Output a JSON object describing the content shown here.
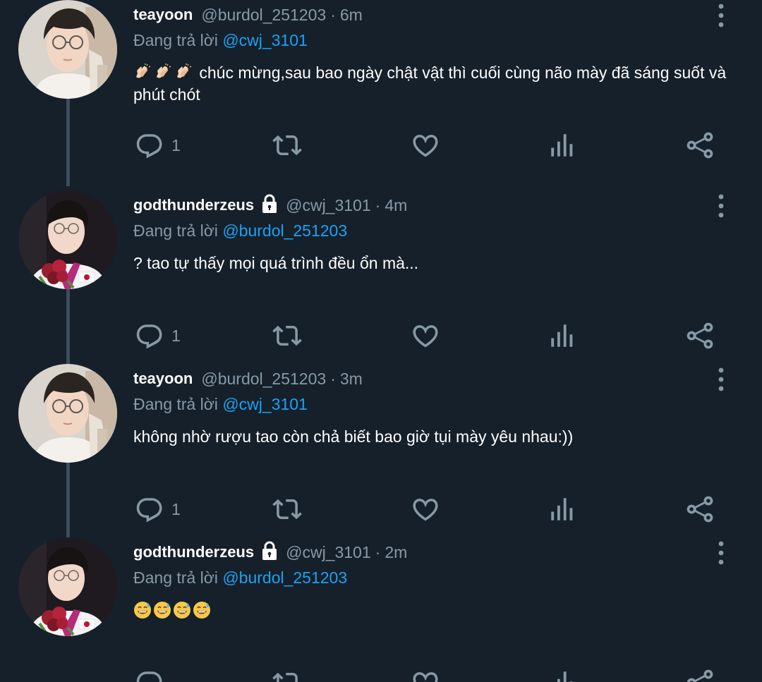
{
  "tweets": [
    {
      "name": "teayoon",
      "locked": false,
      "handle": "@burdol_251203",
      "dot": "·",
      "time": "6m",
      "reply_prefix": "Đang trả lời",
      "reply_to": "@cwj_3101",
      "emoji": "clapping-hands x3",
      "text": "chúc mừng,sau bao ngày chật vật thì cuối cùng não mày đã sáng suốt và phút chót",
      "reply_count": "1",
      "avatar": "profile-photo-teayoon"
    },
    {
      "name": "godthunderzeus",
      "locked": true,
      "handle": "@cwj_3101",
      "dot": "·",
      "time": "4m",
      "reply_prefix": "Đang trả lời",
      "reply_to": "@burdol_251203",
      "text": "? tao tự thấy mọi quá trình đều ổn mà...",
      "reply_count": "1",
      "avatar": "profile-photo-godthunderzeus"
    },
    {
      "name": "teayoon",
      "locked": false,
      "handle": "@burdol_251203",
      "dot": "·",
      "time": "3m",
      "reply_prefix": "Đang trả lời",
      "reply_to": "@cwj_3101",
      "text": "không nhờ rượu tao còn chả biết bao giờ tụi mày yêu nhau:))",
      "reply_count": "1",
      "avatar": "profile-photo-teayoon"
    },
    {
      "name": "godthunderzeus",
      "locked": true,
      "handle": "@cwj_3101",
      "dot": "·",
      "time": "2m",
      "reply_prefix": "Đang trả lời",
      "reply_to": "@burdol_251203",
      "emoji": "grinning-face-with-sweat x4",
      "text": "",
      "reply_count": "",
      "avatar": "profile-photo-godthunderzeus"
    }
  ],
  "colors": {
    "background": "#15202b",
    "text": "#ffffff",
    "secondary": "#8899a6",
    "mention": "#1da1f2",
    "icon": "#8899a6",
    "thread_line": "#3d4d5d"
  },
  "icons": [
    "reply-icon",
    "retweet-icon",
    "like-icon",
    "analytics-icon",
    "share-icon",
    "more-options-icon",
    "lock-icon"
  ]
}
